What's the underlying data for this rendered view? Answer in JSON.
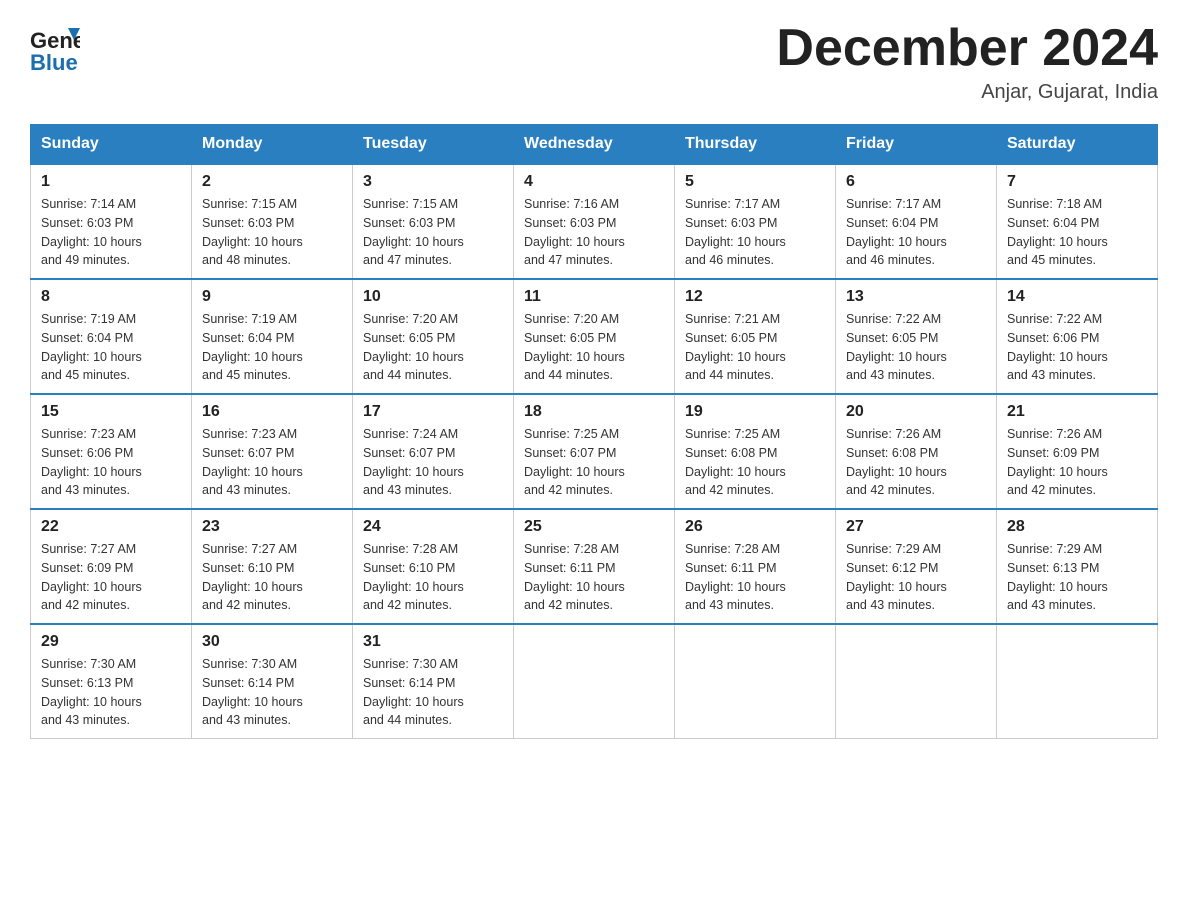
{
  "header": {
    "logo_general": "General",
    "logo_blue": "Blue",
    "month_title": "December 2024",
    "location": "Anjar, Gujarat, India"
  },
  "days_of_week": [
    "Sunday",
    "Monday",
    "Tuesday",
    "Wednesday",
    "Thursday",
    "Friday",
    "Saturday"
  ],
  "weeks": [
    [
      {
        "day": "1",
        "sunrise": "7:14 AM",
        "sunset": "6:03 PM",
        "daylight": "10 hours and 49 minutes."
      },
      {
        "day": "2",
        "sunrise": "7:15 AM",
        "sunset": "6:03 PM",
        "daylight": "10 hours and 48 minutes."
      },
      {
        "day": "3",
        "sunrise": "7:15 AM",
        "sunset": "6:03 PM",
        "daylight": "10 hours and 47 minutes."
      },
      {
        "day": "4",
        "sunrise": "7:16 AM",
        "sunset": "6:03 PM",
        "daylight": "10 hours and 47 minutes."
      },
      {
        "day": "5",
        "sunrise": "7:17 AM",
        "sunset": "6:03 PM",
        "daylight": "10 hours and 46 minutes."
      },
      {
        "day": "6",
        "sunrise": "7:17 AM",
        "sunset": "6:04 PM",
        "daylight": "10 hours and 46 minutes."
      },
      {
        "day": "7",
        "sunrise": "7:18 AM",
        "sunset": "6:04 PM",
        "daylight": "10 hours and 45 minutes."
      }
    ],
    [
      {
        "day": "8",
        "sunrise": "7:19 AM",
        "sunset": "6:04 PM",
        "daylight": "10 hours and 45 minutes."
      },
      {
        "day": "9",
        "sunrise": "7:19 AM",
        "sunset": "6:04 PM",
        "daylight": "10 hours and 45 minutes."
      },
      {
        "day": "10",
        "sunrise": "7:20 AM",
        "sunset": "6:05 PM",
        "daylight": "10 hours and 44 minutes."
      },
      {
        "day": "11",
        "sunrise": "7:20 AM",
        "sunset": "6:05 PM",
        "daylight": "10 hours and 44 minutes."
      },
      {
        "day": "12",
        "sunrise": "7:21 AM",
        "sunset": "6:05 PM",
        "daylight": "10 hours and 44 minutes."
      },
      {
        "day": "13",
        "sunrise": "7:22 AM",
        "sunset": "6:05 PM",
        "daylight": "10 hours and 43 minutes."
      },
      {
        "day": "14",
        "sunrise": "7:22 AM",
        "sunset": "6:06 PM",
        "daylight": "10 hours and 43 minutes."
      }
    ],
    [
      {
        "day": "15",
        "sunrise": "7:23 AM",
        "sunset": "6:06 PM",
        "daylight": "10 hours and 43 minutes."
      },
      {
        "day": "16",
        "sunrise": "7:23 AM",
        "sunset": "6:07 PM",
        "daylight": "10 hours and 43 minutes."
      },
      {
        "day": "17",
        "sunrise": "7:24 AM",
        "sunset": "6:07 PM",
        "daylight": "10 hours and 43 minutes."
      },
      {
        "day": "18",
        "sunrise": "7:25 AM",
        "sunset": "6:07 PM",
        "daylight": "10 hours and 42 minutes."
      },
      {
        "day": "19",
        "sunrise": "7:25 AM",
        "sunset": "6:08 PM",
        "daylight": "10 hours and 42 minutes."
      },
      {
        "day": "20",
        "sunrise": "7:26 AM",
        "sunset": "6:08 PM",
        "daylight": "10 hours and 42 minutes."
      },
      {
        "day": "21",
        "sunrise": "7:26 AM",
        "sunset": "6:09 PM",
        "daylight": "10 hours and 42 minutes."
      }
    ],
    [
      {
        "day": "22",
        "sunrise": "7:27 AM",
        "sunset": "6:09 PM",
        "daylight": "10 hours and 42 minutes."
      },
      {
        "day": "23",
        "sunrise": "7:27 AM",
        "sunset": "6:10 PM",
        "daylight": "10 hours and 42 minutes."
      },
      {
        "day": "24",
        "sunrise": "7:28 AM",
        "sunset": "6:10 PM",
        "daylight": "10 hours and 42 minutes."
      },
      {
        "day": "25",
        "sunrise": "7:28 AM",
        "sunset": "6:11 PM",
        "daylight": "10 hours and 42 minutes."
      },
      {
        "day": "26",
        "sunrise": "7:28 AM",
        "sunset": "6:11 PM",
        "daylight": "10 hours and 43 minutes."
      },
      {
        "day": "27",
        "sunrise": "7:29 AM",
        "sunset": "6:12 PM",
        "daylight": "10 hours and 43 minutes."
      },
      {
        "day": "28",
        "sunrise": "7:29 AM",
        "sunset": "6:13 PM",
        "daylight": "10 hours and 43 minutes."
      }
    ],
    [
      {
        "day": "29",
        "sunrise": "7:30 AM",
        "sunset": "6:13 PM",
        "daylight": "10 hours and 43 minutes."
      },
      {
        "day": "30",
        "sunrise": "7:30 AM",
        "sunset": "6:14 PM",
        "daylight": "10 hours and 43 minutes."
      },
      {
        "day": "31",
        "sunrise": "7:30 AM",
        "sunset": "6:14 PM",
        "daylight": "10 hours and 44 minutes."
      },
      null,
      null,
      null,
      null
    ]
  ],
  "labels": {
    "sunrise": "Sunrise: ",
    "sunset": "Sunset: ",
    "daylight": "Daylight: "
  }
}
